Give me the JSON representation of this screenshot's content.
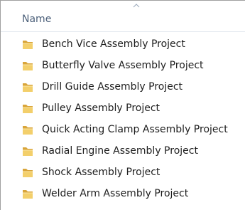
{
  "header": {
    "name_label": "Name",
    "sort_icon": "sort-ascending-icon"
  },
  "items": [
    {
      "label": "Bench Vice Assembly Project",
      "icon": "folder-icon"
    },
    {
      "label": "Butterfly Valve Assembly Project",
      "icon": "folder-icon"
    },
    {
      "label": "Drill Guide Assembly Project",
      "icon": "folder-icon"
    },
    {
      "label": "Pulley Assembly Project",
      "icon": "folder-icon"
    },
    {
      "label": "Quick Acting Clamp Assembly Project",
      "icon": "folder-icon"
    },
    {
      "label": "Radial Engine Assembly Project",
      "icon": "folder-icon"
    },
    {
      "label": "Shock Assembly Project",
      "icon": "folder-icon"
    },
    {
      "label": "Welder Arm Assembly Project",
      "icon": "folder-icon"
    }
  ],
  "colors": {
    "header_text": "#4c607a",
    "item_text": "#1e1e1e",
    "folder_body": "#e8b84a",
    "folder_front": "#f6d77a",
    "border": "#a0a0a0"
  }
}
